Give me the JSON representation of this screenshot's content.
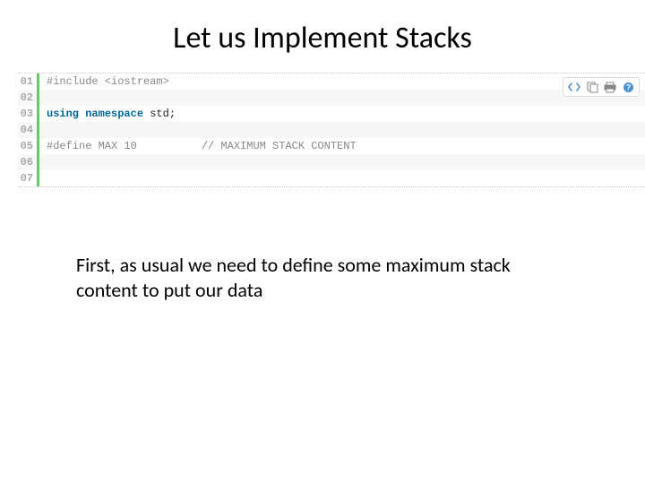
{
  "title": "Let us Implement Stacks",
  "code": {
    "lines": [
      {
        "n": "01",
        "tokens": [
          {
            "t": "#include <iostream>",
            "c": "pp"
          }
        ]
      },
      {
        "n": "02",
        "tokens": []
      },
      {
        "n": "03",
        "tokens": [
          {
            "t": "using",
            "c": "kw"
          },
          {
            "t": " ",
            "c": ""
          },
          {
            "t": "namespace",
            "c": "kw"
          },
          {
            "t": " std;",
            "c": "id"
          }
        ]
      },
      {
        "n": "04",
        "tokens": []
      },
      {
        "n": "05",
        "tokens": [
          {
            "t": "#define MAX 10          ",
            "c": "pp"
          },
          {
            "t": "// MAXIMUM STACK CONTENT",
            "c": "cm"
          }
        ]
      },
      {
        "n": "06",
        "tokens": []
      },
      {
        "n": "07",
        "tokens": []
      }
    ]
  },
  "toolbar": {
    "view_source": "view-source",
    "copy": "copy",
    "print": "print",
    "help": "help"
  },
  "caption": "First, as usual we need to define some maximum stack content to put our data"
}
